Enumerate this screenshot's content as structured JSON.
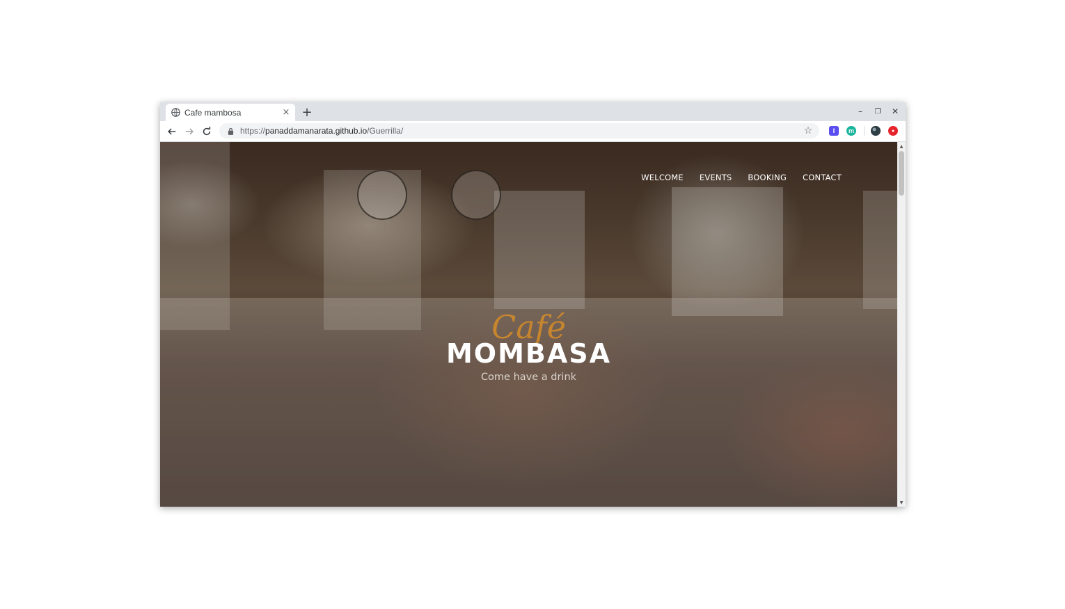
{
  "browser": {
    "tab": {
      "title": "Cafe mambosa",
      "favicon": "globe-icon",
      "close": "×"
    },
    "new_tab": "+",
    "window_controls": {
      "minimize": "–",
      "maximize": "❐",
      "close": "✕"
    },
    "toolbar": {
      "back": "back-arrow-icon",
      "forward": "forward-arrow-icon",
      "reload": "reload-icon",
      "url_scheme": "https://",
      "url_host": "panaddamanarata.github.io",
      "url_path": "/Guerrilla/",
      "bookmark": "☆"
    },
    "extensions": [
      {
        "name": "extension-purple-icon",
        "label": "I",
        "color": "#5b4ef0"
      },
      {
        "name": "extension-teal-icon",
        "label": "m",
        "color": "#19b49c"
      },
      {
        "name": "profile-avatar-icon",
        "label": "",
        "color": "#3a4a52"
      },
      {
        "name": "extension-red-icon",
        "label": "●",
        "color": "#e5232b"
      }
    ]
  },
  "site": {
    "nav": [
      "WELCOME",
      "EVENTS",
      "BOOKING",
      "CONTACT"
    ],
    "hero": {
      "script_title": "Café",
      "title": "MOMBASA",
      "tagline": "Come have a drink"
    }
  }
}
